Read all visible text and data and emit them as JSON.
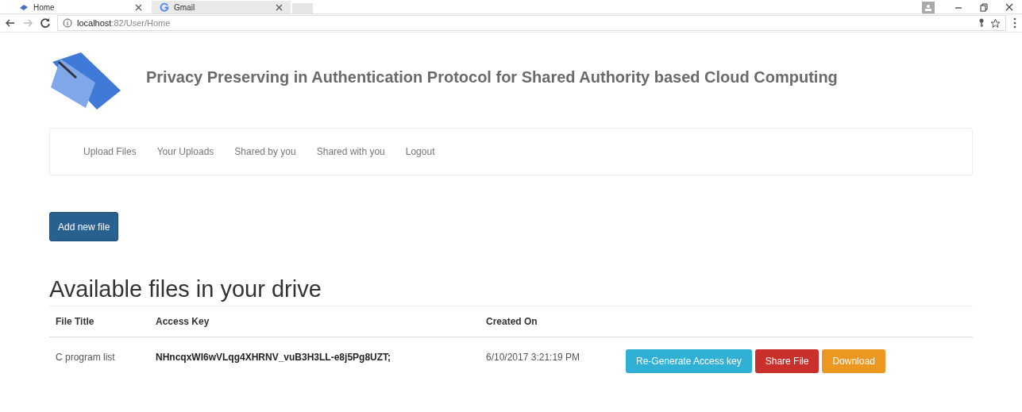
{
  "browser": {
    "tabs": [
      {
        "label": "Home",
        "selected": true
      },
      {
        "label": "Gmail",
        "selected": false
      }
    ],
    "address": {
      "host": "localhost",
      "rest": ":82/User/Home"
    }
  },
  "site": {
    "title": "Privacy Preserving in Authentication Protocol for Shared Authority based Cloud Computing"
  },
  "nav": [
    "Upload Files",
    "Your Uploads",
    "Shared by you",
    "Shared with you",
    "Logout"
  ],
  "add_button": "Add new file",
  "heading": "Available files in your drive",
  "table": {
    "columns": [
      "File Title",
      "Access Key",
      "Created On"
    ],
    "rows": [
      {
        "cells": [
          "C program list",
          "NHncqxWI6wVLqg4XHRNV_vuB3H3LL-e8j5Pg8UZT;",
          "6/10/2017 3:21:19 PM"
        ],
        "actions": [
          {
            "label": "Re-Generate Access key",
            "kind": "info"
          },
          {
            "label": "Share File",
            "kind": "danger"
          },
          {
            "label": "Download",
            "kind": "warning"
          }
        ]
      }
    ]
  }
}
